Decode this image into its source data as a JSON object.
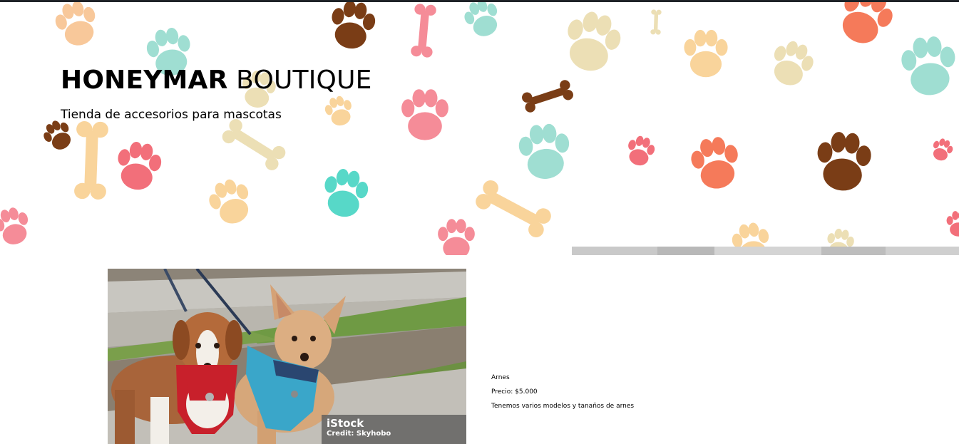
{
  "header": {
    "title_bold": "HONEYMAR",
    "title_rest": " BOUTIQUE",
    "tagline": "Tienda de accesorios para mascotas"
  },
  "hero_pattern": {
    "icons": [
      "paw-print-icon",
      "bone-icon"
    ],
    "colors": [
      "#f8c89a",
      "#9fded2",
      "#f58c98",
      "#f26f7a",
      "#7a3d16",
      "#f5a783",
      "#ecdfb5",
      "#f57a5a",
      "#57d8c8",
      "#f9d49b"
    ]
  },
  "product": {
    "image_alt": "Dos perros con arneses rojo y azul",
    "image_credit_brand": "iStock",
    "image_credit_line": "Credit: Skyhobo",
    "name": "Arnes",
    "price": "Precio: $5.000",
    "description": "Tenemos varios modelos y tanaños de arnes"
  },
  "colors": {
    "top_strip": "#1f2328",
    "text": "#000000",
    "harness_red": "#c8202b",
    "harness_blue": "#3aa6c9"
  }
}
